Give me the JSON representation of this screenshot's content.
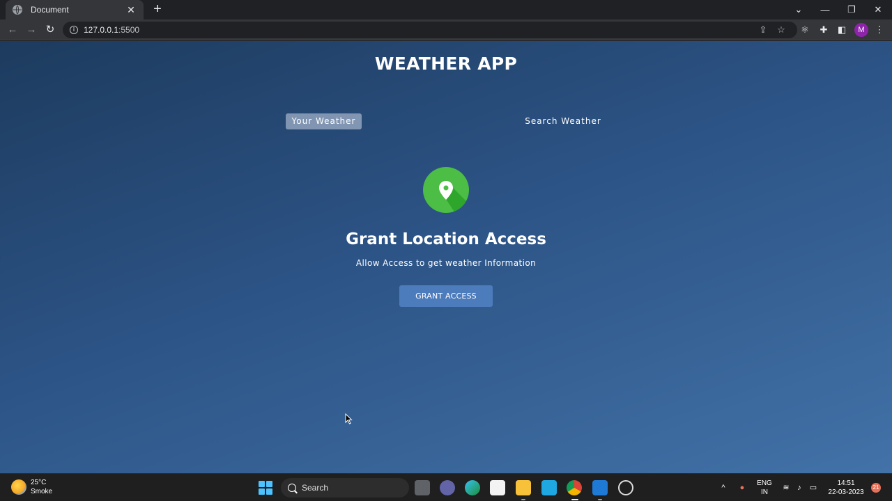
{
  "browser": {
    "tab_title": "Document",
    "tab_close": "✕",
    "new_tab": "+",
    "url_host": "127.0.0.1",
    "url_port": ":5500",
    "profile_initial": "M"
  },
  "app": {
    "title": "WEATHER APP",
    "tabs": {
      "your_weather": "Your Weather",
      "search_weather": "Search Weather"
    },
    "grant": {
      "title": "Grant Location Access",
      "subtitle": "Allow Access to get weather Information",
      "button": "GRANT ACCESS"
    },
    "colors": {
      "active_tab_bg": "#aab9d2",
      "grant_button": "#4d7cbd",
      "location_icon": "#4cbd45"
    }
  },
  "taskbar": {
    "weather_temp": "25°C",
    "weather_desc": "Smoke",
    "search_placeholder": "Search",
    "lang_top": "ENG",
    "lang_bottom": "IN",
    "time": "14:51",
    "date": "22-03-2023",
    "notification_count": "21"
  }
}
